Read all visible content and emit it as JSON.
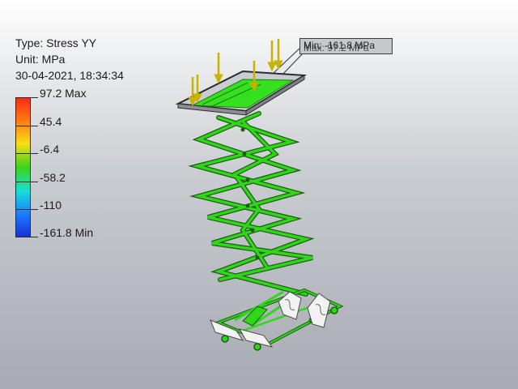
{
  "result_header": {
    "type_line": "Type: Stress YY",
    "unit_line": "Unit: MPa",
    "timestamp_line": "30-04-2021, 18:34:34"
  },
  "legend": {
    "labels": [
      "97.2 Max",
      "45.4",
      "-6.4",
      "-58.2",
      "-110",
      "-161.8 Min"
    ],
    "colors": [
      "#ff2a1a",
      "#ff7a10",
      "#f6e015",
      "#39d31a",
      "#17e0d8",
      "#1b7bff",
      "#1a2fd5"
    ]
  },
  "probe_callout": {
    "min_label": "Min: -161.8 MPa",
    "max_label": "Max: 97.2 MPa"
  },
  "model": {
    "primary_color": "#2fd61a",
    "load_arrow_color": "#c8b400",
    "pad_color": "#f2f2f2"
  }
}
